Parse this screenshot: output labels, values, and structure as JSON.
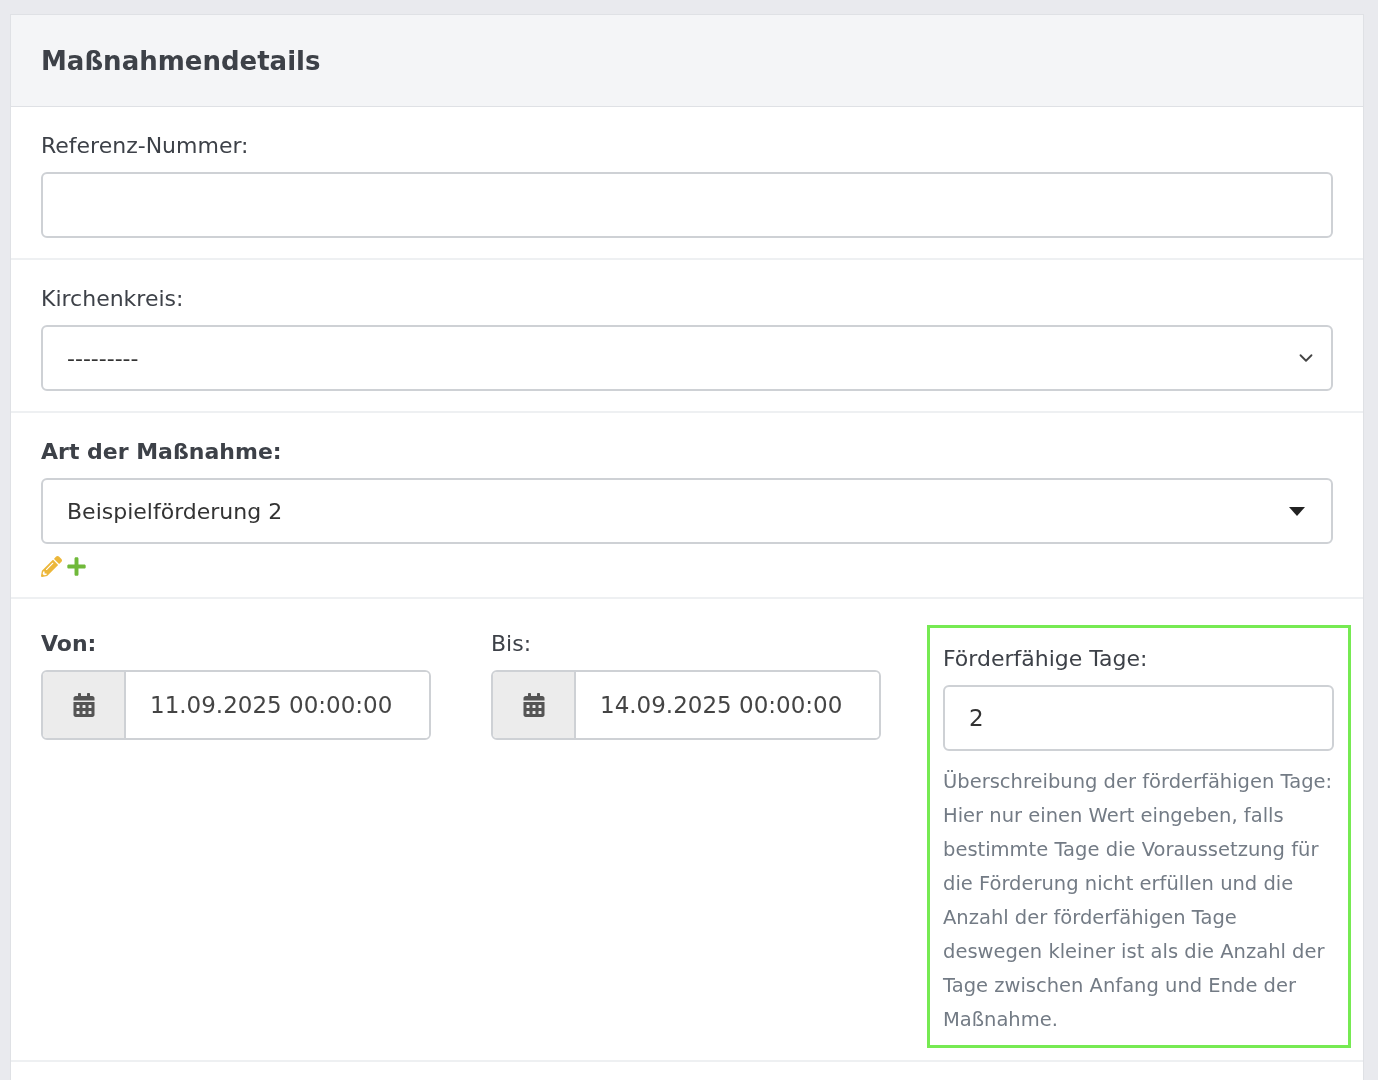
{
  "panel": {
    "title": "Maßnahmendetails"
  },
  "fields": [
    {
      "kind": "text",
      "label": "Referenz-Nummer:",
      "bold": false
    },
    {
      "kind": "select",
      "label": "Kirchenkreis:",
      "bold": false,
      "value": "---------"
    },
    {
      "kind": "combo",
      "label": "Art der Maßnahme:",
      "bold": true,
      "value": "Beispielförderung 2"
    }
  ],
  "dates": [
    {
      "label": "Von:",
      "bold": true,
      "value": "11.09.2025 00:00:00"
    },
    {
      "label": "Bis:",
      "bold": false,
      "value": "14.09.2025 00:00:00"
    }
  ],
  "days": {
    "label": "Förderfähige Tage:",
    "bold": false,
    "value": "2",
    "highlighted": true,
    "help": "Überschreibung der förderfähigen Tage: Hier nur einen Wert eingeben, falls bestimmte Tage die Voraussetzung für die Förderung nicht erfüllen und die Anzahl der förderfähigen Tage deswegen kleiner ist als die Anzahl der Tage zwischen Anfang und Ende der Maßnahme."
  }
}
